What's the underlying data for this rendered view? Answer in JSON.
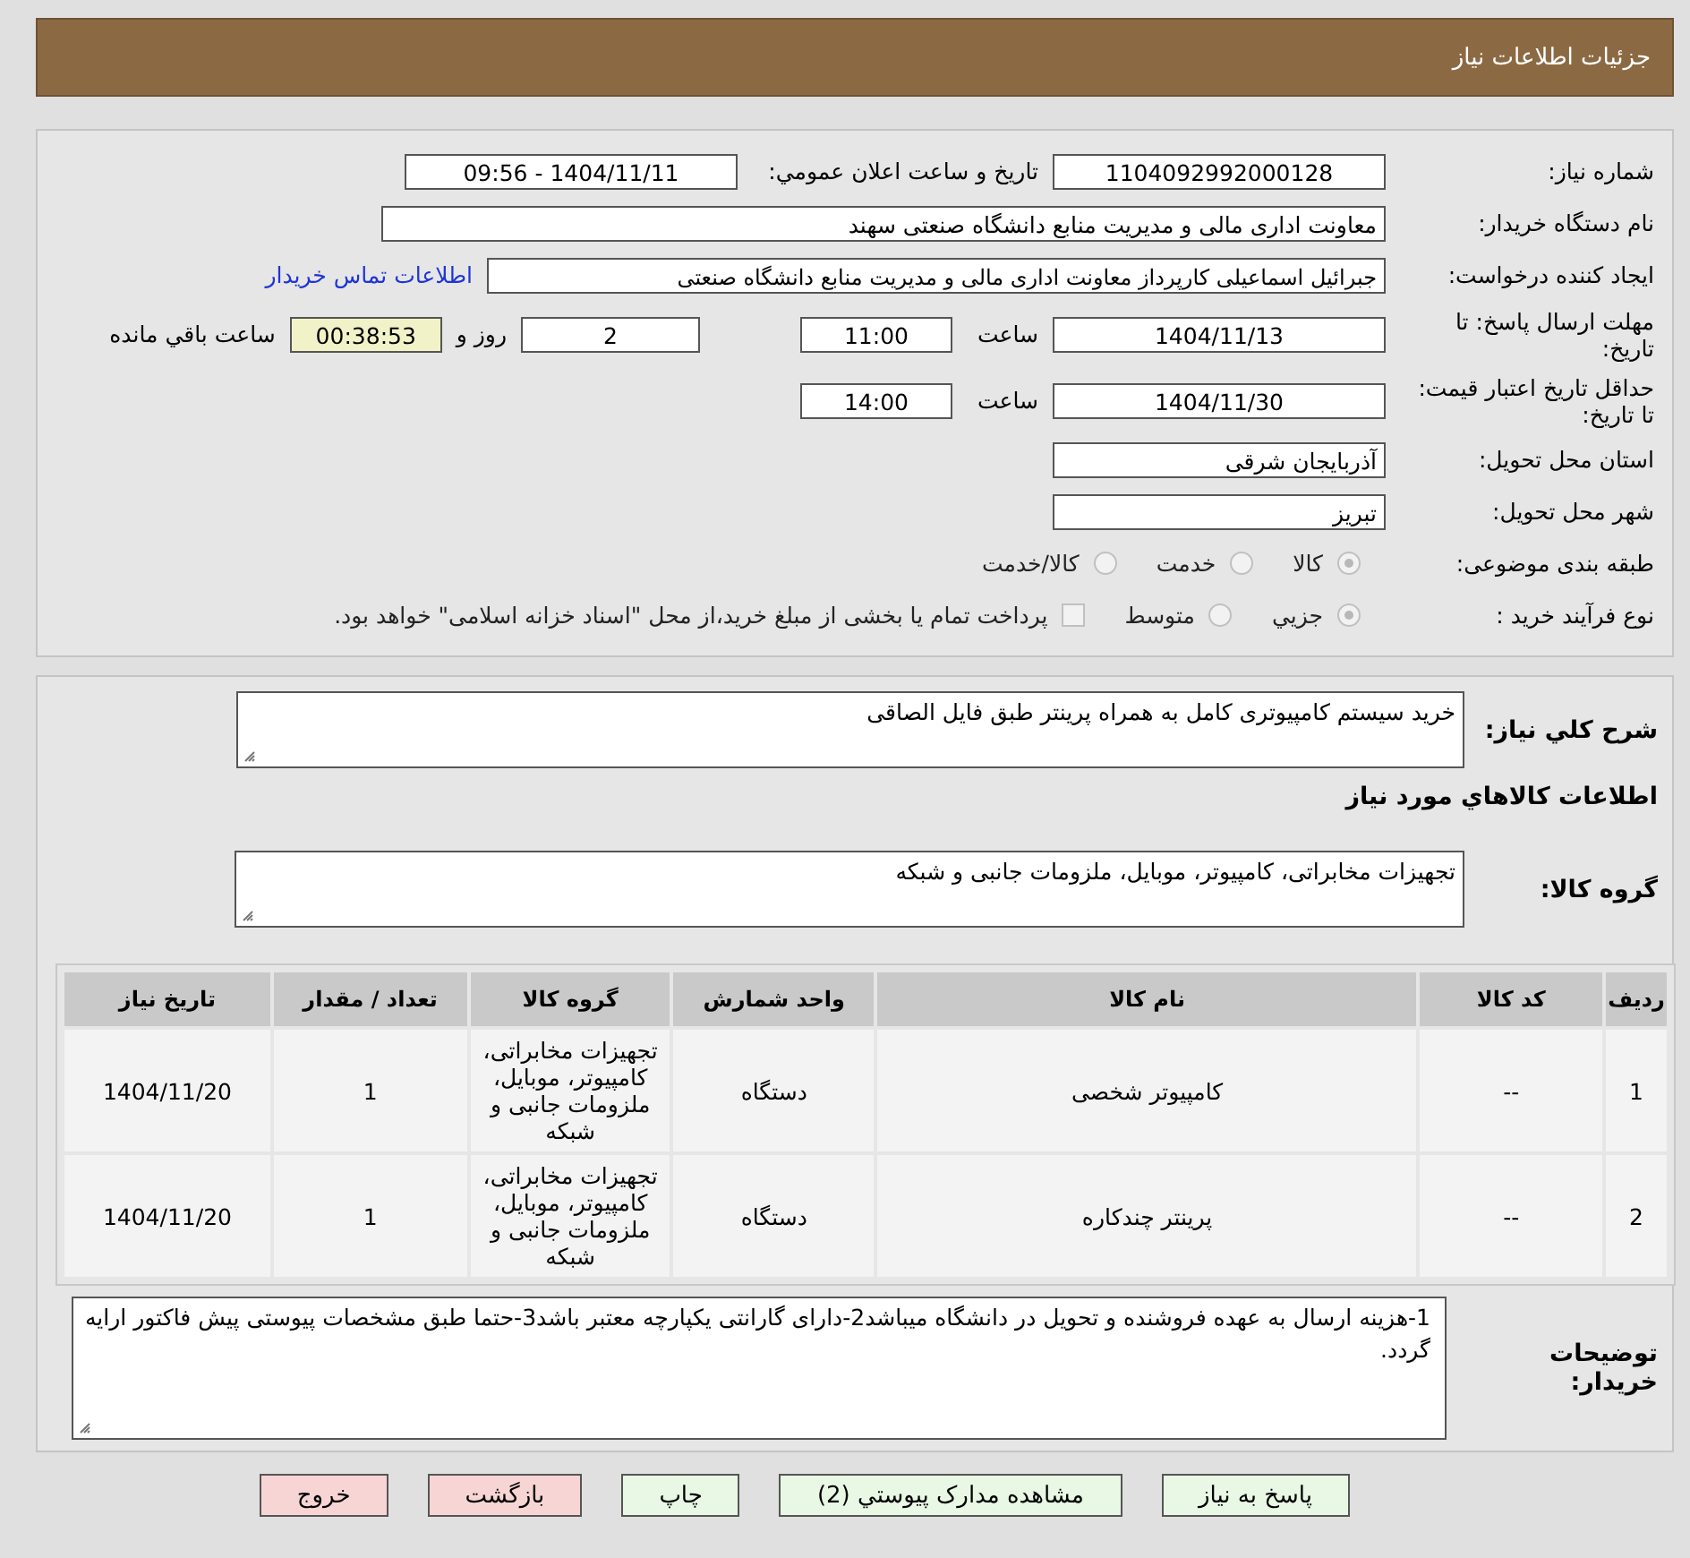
{
  "header": {
    "title": "جزئیات اطلاعات نیاز"
  },
  "need_number": {
    "label": "شماره نیاز:",
    "value": "1104092992000128"
  },
  "announce": {
    "label": "تاریخ و ساعت اعلان عمومي:",
    "value": "1404/11/11 - 09:56"
  },
  "buyer_org": {
    "label": "نام دستگاه خریدار:",
    "value": "معاونت اداری  مالی و مدیریت منابع دانشگاه صنعتی سهند"
  },
  "requester": {
    "label": "ایجاد کننده درخواست:",
    "value": "جبرائیل اسماعیلی کارپرداز معاونت اداری  مالی و مدیریت منابع دانشگاه صنعتی",
    "link": "اطلاعات تماس خریدار"
  },
  "deadline": {
    "label": "مهلت ارسال پاسخ: تا تاریخ:",
    "date": "1404/11/13",
    "time_label": "ساعت",
    "time": "11:00",
    "days": "2",
    "days_label": "روز و",
    "remaining": "00:38:53",
    "remaining_label": "ساعت باقي مانده"
  },
  "validity": {
    "label": "حداقل تاریخ اعتبار قیمت: تا تاریخ:",
    "date": "1404/11/30",
    "time_label": "ساعت",
    "time": "14:00"
  },
  "province": {
    "label": "استان محل تحویل:",
    "value": "آذربایجان شرقی"
  },
  "city": {
    "label": "شهر محل تحویل:",
    "value": "تبریز"
  },
  "category": {
    "label": "طبقه بندی موضوعی:",
    "options": [
      {
        "label": "کالا",
        "selected": true
      },
      {
        "label": "خدمت",
        "selected": false
      },
      {
        "label": "کالا/خدمت",
        "selected": false
      }
    ]
  },
  "process": {
    "label": "نوع فرآیند خرید :",
    "options": [
      {
        "label": "جزيي",
        "selected": true
      },
      {
        "label": "متوسط",
        "selected": false
      }
    ],
    "checkbox": {
      "label": "پرداخت تمام یا بخشی از مبلغ خرید،از محل \"اسناد خزانه اسلامی\" خواهد بود.",
      "checked": false
    }
  },
  "description": {
    "label": "شرح کلي نیاز:",
    "value": "خرید سیستم کامپیوتری کامل به همراه پرینتر طبق فایل الصاقی"
  },
  "items_heading": "اطلاعات کالاهاي مورد نیاز",
  "goods_group": {
    "label": "گروه کالا:",
    "value": "تجهیزات مخابراتی، کامپیوتر، موبایل، ملزومات جانبی و شبکه"
  },
  "table": {
    "columns": [
      "ردیف",
      "کد کالا",
      "نام کالا",
      "واحد شمارش",
      "گروه کالا",
      "تعداد / مقدار",
      "تاریخ نیاز"
    ],
    "rows": [
      [
        "1",
        "--",
        "کامپیوتر شخصی",
        "دستگاه",
        "تجهیزات مخابراتی، کامپیوتر، موبایل، ملزومات جانبی و شبکه",
        "1",
        "1404/11/20"
      ],
      [
        "2",
        "--",
        "پرینتر چندکاره",
        "دستگاه",
        "تجهیزات مخابراتی، کامپیوتر، موبایل، ملزومات جانبی و شبکه",
        "1",
        "1404/11/20"
      ]
    ]
  },
  "buyer_notes": {
    "label": "توضیحات خریدار:",
    "value": "1-هزینه ارسال به عهده فروشنده و تحویل در دانشگاه میباشد2-دارای گارانتی یکپارچه معتبر باشد3-حتما طبق مشخصات پیوستی پیش فاکتور ارایه گردد."
  },
  "buttons": [
    {
      "label": "پاسخ به نیاز",
      "kind": "action"
    },
    {
      "label": "مشاهده مدارک پیوستي (2)",
      "kind": "action"
    },
    {
      "label": "چاپ",
      "kind": "action"
    },
    {
      "label": "بازگشت",
      "kind": "exit"
    },
    {
      "label": "خروج",
      "kind": "exit"
    }
  ]
}
